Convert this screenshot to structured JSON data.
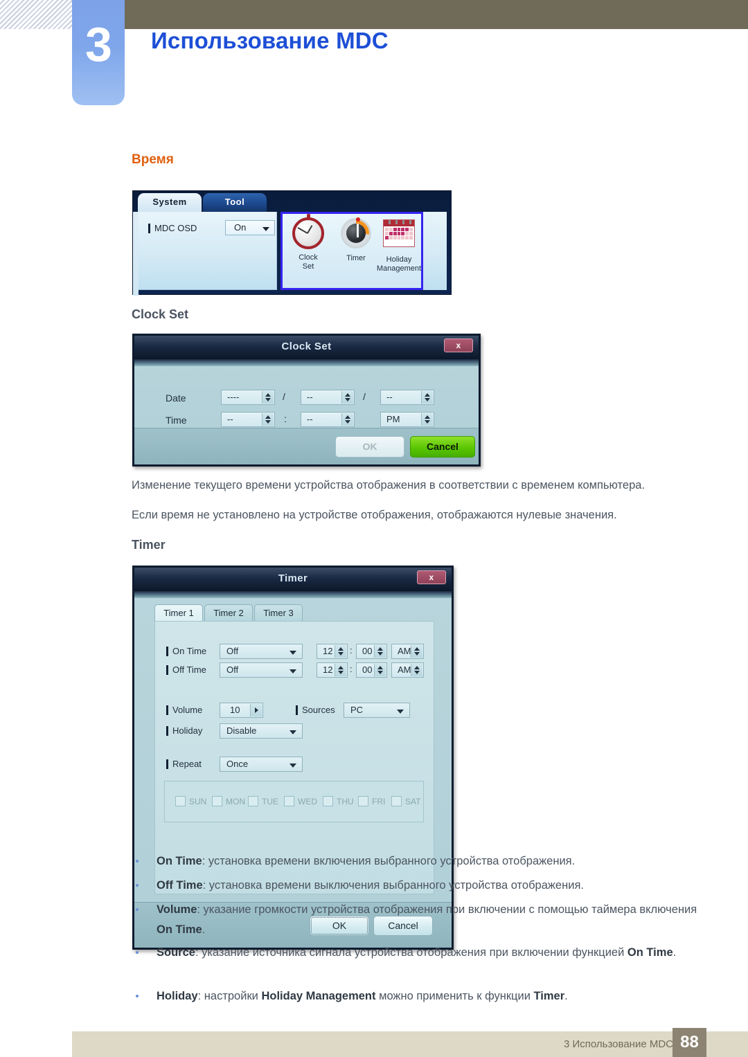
{
  "header": {
    "chapter_number": "3",
    "chapter_title": "Использование MDC"
  },
  "section": {
    "heading": "Время",
    "clock_set_heading": "Clock Set",
    "timer_heading": "Timer"
  },
  "ribbon": {
    "tabs": [
      {
        "label": "System",
        "active": true
      },
      {
        "label": "Tool",
        "active": false
      }
    ],
    "osd": {
      "label": "MDC OSD",
      "value": "On"
    },
    "items": [
      {
        "icon": "clock-icon",
        "line1": "Clock",
        "line2": "Set"
      },
      {
        "icon": "timer-icon",
        "line1": "Timer",
        "line2": ""
      },
      {
        "icon": "calendar-icon",
        "line1": "Holiday",
        "line2": "Management"
      }
    ]
  },
  "clock_set_dialog": {
    "title": "Clock Set",
    "close_label": "x",
    "date_label": "Date",
    "time_label": "Time",
    "date_year": "----",
    "date_month": "--",
    "date_day": "--",
    "date_sep1": "/",
    "date_sep2": "/",
    "time_hour": "--",
    "time_minute": "--",
    "time_meridiem": "PM",
    "time_sep": ":",
    "ok_label": "OK",
    "cancel_label": "Cancel"
  },
  "paragraphs": {
    "p1": "Изменение текущего времени устройства отображения в соответствии с временем компьютера.",
    "p2": "Если время не установлено на устройстве отображения, отображаются нулевые значения."
  },
  "timer_dialog": {
    "title": "Timer",
    "close_label": "x",
    "tabs": [
      {
        "label": "Timer 1",
        "active": true
      },
      {
        "label": "Timer 2",
        "active": false
      },
      {
        "label": "Timer 3",
        "active": false
      }
    ],
    "on_time": {
      "label": "On Time",
      "mode": "Off",
      "hour": "12",
      "minute": "00",
      "meridiem": "AM",
      "sep": ":"
    },
    "off_time": {
      "label": "Off Time",
      "mode": "Off",
      "hour": "12",
      "minute": "00",
      "meridiem": "AM",
      "sep": ":"
    },
    "volume": {
      "label": "Volume",
      "value": "10"
    },
    "sources": {
      "label": "Sources",
      "value": "PC"
    },
    "holiday": {
      "label": "Holiday",
      "value": "Disable"
    },
    "repeat": {
      "label": "Repeat",
      "value": "Once"
    },
    "days": [
      "SUN",
      "MON",
      "TUE",
      "WED",
      "THU",
      "FRI",
      "SAT"
    ],
    "ok_label": "OK",
    "cancel_label": "Cancel"
  },
  "bullets": [
    {
      "term": "On Time",
      "rest": ": установка времени включения выбранного устройства отображения."
    },
    {
      "term": "Off Time",
      "rest": ": установка времени выключения выбранного устройства отображения."
    },
    {
      "term": "Volume",
      "rest": ": указание громкости устройства отображения при включении с помощью таймера включения ",
      "term2": "On Time",
      "tail": "."
    },
    {
      "term": "Source",
      "rest": ": указание источника сигнала устройства отображения при включении функцией ",
      "term2": "On Time",
      "tail": "."
    },
    {
      "term": "Holiday",
      "rest": ": настройки ",
      "term2": "Holiday Management",
      "mid": " можно применить к функции ",
      "term3": "Timer",
      "tail": "."
    }
  ],
  "footer": {
    "text": "3 Использование MDC",
    "page": "88"
  },
  "colors": {
    "accent_orange": "#e06010",
    "chapter_blue": "#1d4fd6",
    "header_olive": "#6f6b58",
    "footer_beige": "#ded8c6"
  }
}
